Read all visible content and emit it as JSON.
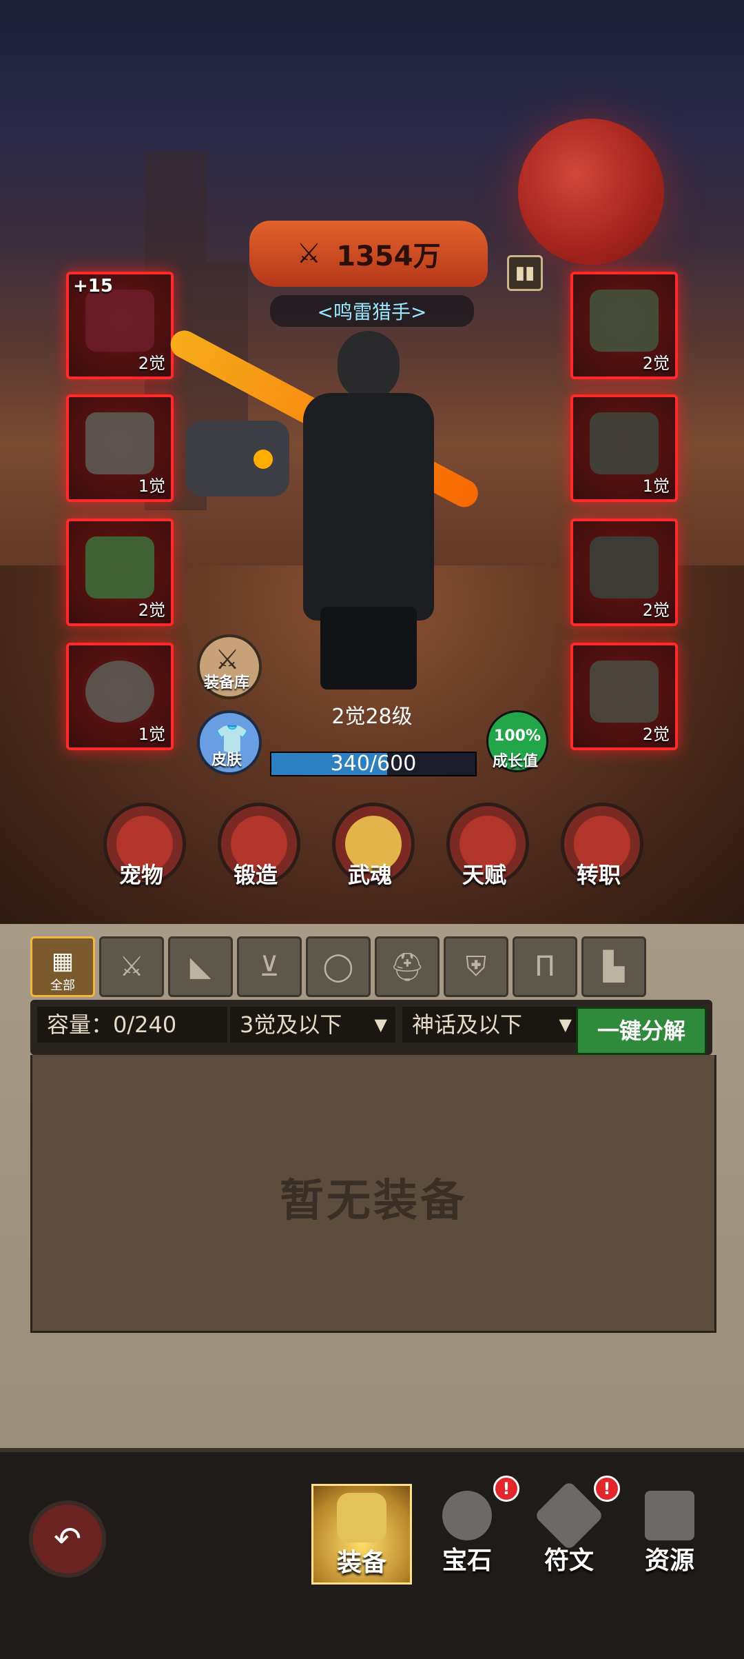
{
  "hero": {
    "power": "1354万",
    "title": "<鸣雷猎手>",
    "level": "2觉28级",
    "xp_text": "340/600",
    "xp_fraction": 0.5667,
    "growth_pct": "100%",
    "growth_label": "成长值"
  },
  "equipment_left": [
    {
      "plus": "+15",
      "awaken": "2觉"
    },
    {
      "plus": "",
      "awaken": "1觉"
    },
    {
      "plus": "",
      "awaken": "2觉"
    },
    {
      "plus": "",
      "awaken": "1觉"
    }
  ],
  "equipment_right": [
    {
      "awaken": "2觉"
    },
    {
      "awaken": "1觉"
    },
    {
      "awaken": "2觉"
    },
    {
      "awaken": "2觉"
    }
  ],
  "quick_buttons": {
    "armory": "装备库",
    "skin": "皮肤"
  },
  "nav_circles": [
    "宠物",
    "锻造",
    "武魂",
    "天赋",
    "转职"
  ],
  "tabs": [
    {
      "label": "全部",
      "icon": "grid-icon"
    },
    {
      "label": "",
      "icon": "sword-icon"
    },
    {
      "label": "",
      "icon": "cloak-icon"
    },
    {
      "label": "",
      "icon": "necklace-icon"
    },
    {
      "label": "",
      "icon": "ring-icon"
    },
    {
      "label": "",
      "icon": "helmet-icon"
    },
    {
      "label": "",
      "icon": "armor-icon"
    },
    {
      "label": "",
      "icon": "pants-icon"
    },
    {
      "label": "",
      "icon": "boot-icon"
    }
  ],
  "filters": {
    "capacity": "容量：0/240",
    "awaken_filter": "3觉及以下",
    "rarity_filter": "神话及以下",
    "decompose": "一键分解"
  },
  "empty_text": "暂无装备",
  "bottom_nav": [
    {
      "label": "装备",
      "icon": "armor-icon",
      "badge": false
    },
    {
      "label": "宝石",
      "icon": "gem-icon",
      "badge": true
    },
    {
      "label": "符文",
      "icon": "rune-icon",
      "badge": true
    },
    {
      "label": "资源",
      "icon": "chest-icon",
      "badge": false
    }
  ],
  "badge_text": "!",
  "colors": {
    "accent_green": "#2f8a3c",
    "xp_blue": "#2d7fc0",
    "slot_red": "#ff2a2a",
    "gold": "#e2b44a"
  }
}
